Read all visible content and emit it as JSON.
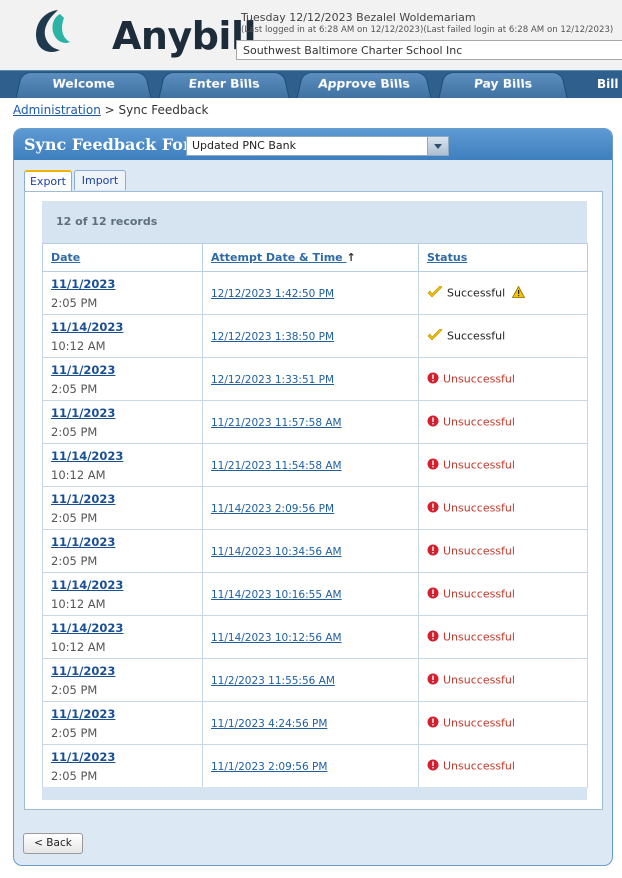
{
  "app": {
    "name": "Anybill"
  },
  "user": {
    "line1": "Tuesday 12/12/2023  Bezalel Woldemariam",
    "line2": "(Last logged in at 6:28 AM on 12/12/2023)(Last failed login at 6:28 AM on 12/12/2023)",
    "school": "Southwest Baltimore Charter School Inc"
  },
  "nav": {
    "tabs": [
      "Welcome",
      "Enter Bills",
      "Approve Bills",
      "Pay Bills"
    ],
    "extra": "Bill S"
  },
  "breadcrumb": {
    "parent": "Administration",
    "separator": ">",
    "current": "Sync Feedback"
  },
  "panel": {
    "title": "Sync Feedback For",
    "bank": "Updated PNC Bank",
    "tabs": [
      "Export",
      "Import"
    ],
    "records": "12 of 12 records",
    "columns": [
      "Date",
      "Attempt Date & Time",
      "Status"
    ],
    "sort_indicator": "↑",
    "back": "< Back"
  },
  "rows": [
    {
      "date": "11/1/2023",
      "time": "2:05 PM",
      "attempt": "12/12/2023 1:42:50 PM",
      "status": "Successful",
      "state": "warn"
    },
    {
      "date": "11/14/2023",
      "time": "10:12 AM",
      "attempt": "12/12/2023 1:38:50 PM",
      "status": "Successful",
      "state": "ok"
    },
    {
      "date": "11/1/2023",
      "time": "2:05 PM",
      "attempt": "12/12/2023 1:33:51 PM",
      "status": "Unsuccessful",
      "state": "error"
    },
    {
      "date": "11/1/2023",
      "time": "2:05 PM",
      "attempt": "11/21/2023 11:57:58 AM",
      "status": "Unsuccessful",
      "state": "error"
    },
    {
      "date": "11/14/2023",
      "time": "10:12 AM",
      "attempt": "11/21/2023 11:54:58 AM",
      "status": "Unsuccessful",
      "state": "error"
    },
    {
      "date": "11/1/2023",
      "time": "2:05 PM",
      "attempt": "11/14/2023 2:09:56 PM",
      "status": "Unsuccessful",
      "state": "error"
    },
    {
      "date": "11/1/2023",
      "time": "2:05 PM",
      "attempt": "11/14/2023 10:34:56 AM",
      "status": "Unsuccessful",
      "state": "error"
    },
    {
      "date": "11/14/2023",
      "time": "10:12 AM",
      "attempt": "11/14/2023 10:16:55 AM",
      "status": "Unsuccessful",
      "state": "error"
    },
    {
      "date": "11/14/2023",
      "time": "10:12 AM",
      "attempt": "11/14/2023 10:12:56 AM",
      "status": "Unsuccessful",
      "state": "error"
    },
    {
      "date": "11/1/2023",
      "time": "2:05 PM",
      "attempt": "11/2/2023 11:55:56 AM",
      "status": "Unsuccessful",
      "state": "error"
    },
    {
      "date": "11/1/2023",
      "time": "2:05 PM",
      "attempt": "11/1/2023 4:24:56 PM",
      "status": "Unsuccessful",
      "state": "error"
    },
    {
      "date": "11/1/2023",
      "time": "2:05 PM",
      "attempt": "11/1/2023 2:09:56 PM",
      "status": "Unsuccessful",
      "state": "error"
    }
  ],
  "colors": {
    "nav": "#2e5f8d",
    "panel_head": "#4a8bc9",
    "link": "#1f5fa0",
    "error": "#c0392b",
    "success_check": "#f2c200"
  },
  "icons": {
    "success": "checkmark-icon",
    "warning": "warning-triangle-icon",
    "error": "error-circle-icon"
  }
}
